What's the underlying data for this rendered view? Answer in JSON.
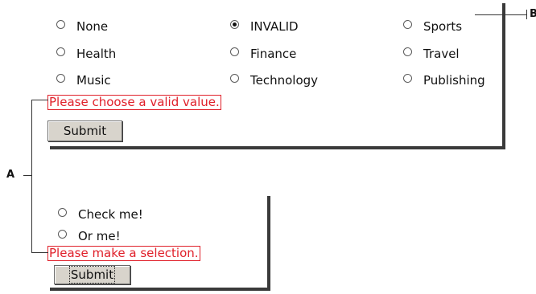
{
  "category_form": {
    "options": [
      {
        "label": "None",
        "checked": false
      },
      {
        "label": "INVALID",
        "checked": true
      },
      {
        "label": "Sports",
        "checked": false
      },
      {
        "label": "Health",
        "checked": false
      },
      {
        "label": "Finance",
        "checked": false
      },
      {
        "label": "Travel",
        "checked": false
      },
      {
        "label": "Music",
        "checked": false
      },
      {
        "label": "Technology",
        "checked": false
      },
      {
        "label": "Publishing",
        "checked": false
      }
    ],
    "error_message": "Please choose a valid value.",
    "submit_label": "Submit"
  },
  "selection_form": {
    "options": [
      {
        "label": "Check me!",
        "checked": false
      },
      {
        "label": "Or me!",
        "checked": false
      }
    ],
    "error_message": "Please make a selection.",
    "submit_label": "Submit"
  },
  "callouts": {
    "a": "A",
    "b": "B"
  }
}
